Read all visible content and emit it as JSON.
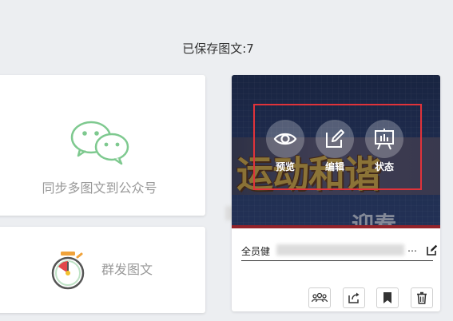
{
  "header": {
    "saved_count": "已保存图文:7"
  },
  "sync_card": {
    "label": "同步多图文到公众号"
  },
  "group_card": {
    "label": "群发图文"
  },
  "article": {
    "cover_text": "运动和谐",
    "cover_subtext": "迎春",
    "actions": [
      {
        "label": "预览"
      },
      {
        "label": "编辑"
      },
      {
        "label": "状态"
      }
    ],
    "title": "全员健",
    "title_ellipsis": "…",
    "highlight_color": "#e0333a"
  },
  "colors": {
    "wechat_green": "#7ec98f",
    "accent_red": "#e0333a"
  }
}
